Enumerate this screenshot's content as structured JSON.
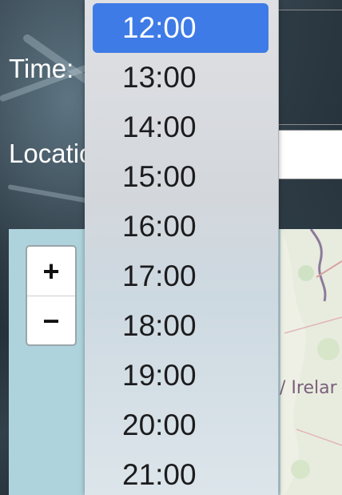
{
  "form": {
    "time_label": "Time:",
    "location_label": "Location:"
  },
  "time_select": {
    "selected": "12:00",
    "options": [
      "12:00",
      "13:00",
      "14:00",
      "15:00",
      "16:00",
      "17:00",
      "18:00",
      "19:00",
      "20:00",
      "21:00"
    ]
  },
  "map": {
    "zoom_in": "+",
    "zoom_out": "−",
    "place_label": "/ Irelar"
  },
  "colors": {
    "selected_option": "#3e7be7",
    "water": "#aed3dc"
  }
}
